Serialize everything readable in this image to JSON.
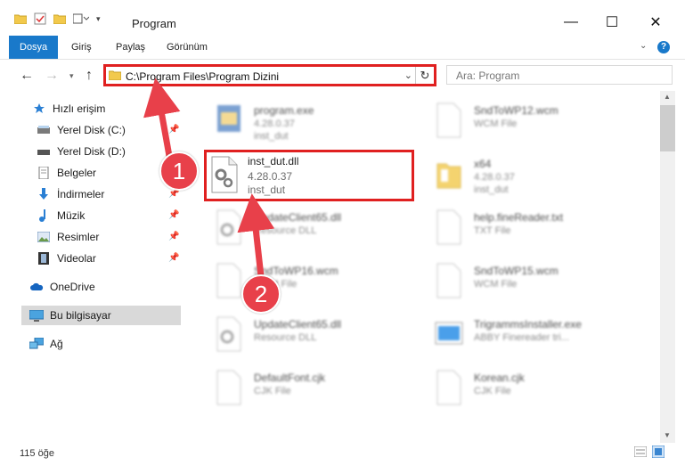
{
  "window": {
    "title": "Program"
  },
  "ribbon": {
    "tabs": [
      "Dosya",
      "Giriş",
      "Paylaş",
      "Görünüm"
    ]
  },
  "address": {
    "path": "C:\\Program Files\\Program Dizini"
  },
  "search": {
    "placeholder": "Ara: Program"
  },
  "sidebar": {
    "items": [
      {
        "label": "Hızlı erişim"
      },
      {
        "label": "Yerel Disk (C:)"
      },
      {
        "label": "Yerel Disk (D:)"
      },
      {
        "label": "Belgeler"
      },
      {
        "label": "İndirmeler"
      },
      {
        "label": "Müzik"
      },
      {
        "label": "Resimler"
      },
      {
        "label": "Videolar"
      },
      {
        "label": "OneDrive"
      },
      {
        "label": "Bu bilgisayar"
      },
      {
        "label": "Ağ"
      }
    ]
  },
  "files": [
    {
      "name": "program.exe",
      "meta1": "4.28.0.37",
      "meta2": "inst_dut"
    },
    {
      "name": "SndToWP12.wcm",
      "meta1": "WCM File",
      "meta2": ""
    },
    {
      "name": "inst_dut.dll",
      "meta1": "4.28.0.37",
      "meta2": "inst_dut"
    },
    {
      "name": "x64",
      "meta1": "4.28.0.37",
      "meta2": "inst_dut"
    },
    {
      "name": "UpdateClient65.dll",
      "meta1": "Resource DLL",
      "meta2": ""
    },
    {
      "name": "help.fineReader.txt",
      "meta1": "TXT File",
      "meta2": ""
    },
    {
      "name": "SndToWP16.wcm",
      "meta1": "WCM File",
      "meta2": ""
    },
    {
      "name": "SndToWP15.wcm",
      "meta1": "WCM File",
      "meta2": ""
    },
    {
      "name": "UpdateClient65.dll",
      "meta1": "Resource DLL",
      "meta2": ""
    },
    {
      "name": "TrigrammsInstaller.exe",
      "meta1": "ABBY Finereader tri...",
      "meta2": ""
    },
    {
      "name": "DefaultFont.cjk",
      "meta1": "CJK File",
      "meta2": ""
    },
    {
      "name": "Korean.cjk",
      "meta1": "CJK File",
      "meta2": ""
    }
  ],
  "annotations": [
    "1",
    "2"
  ],
  "status": {
    "count": "115 öğe"
  },
  "colors": {
    "accent": "#1979ca",
    "highlight": "#e02020",
    "badge": "#e8404a"
  }
}
